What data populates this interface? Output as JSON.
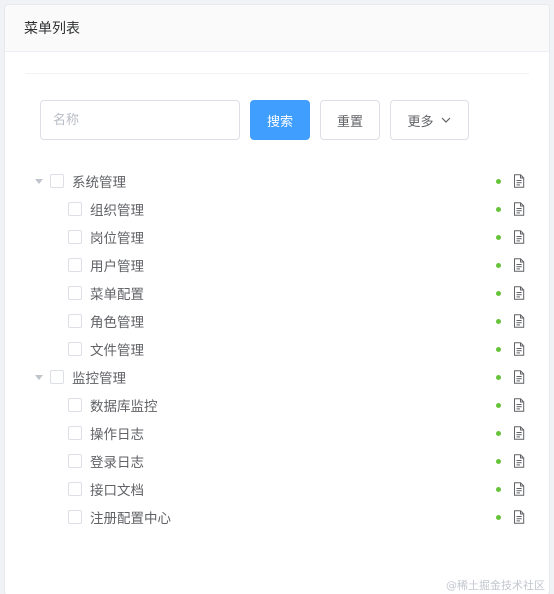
{
  "header": {
    "title": "菜单列表"
  },
  "toolbar": {
    "search_placeholder": "名称",
    "search_value": "",
    "search_label": "搜索",
    "reset_label": "重置",
    "more_label": "更多"
  },
  "tree": [
    {
      "label": "系统管理",
      "level": 0,
      "expanded": true,
      "status": "enabled"
    },
    {
      "label": "组织管理",
      "level": 1,
      "status": "enabled"
    },
    {
      "label": "岗位管理",
      "level": 1,
      "status": "enabled"
    },
    {
      "label": "用户管理",
      "level": 1,
      "status": "enabled"
    },
    {
      "label": "菜单配置",
      "level": 1,
      "status": "enabled"
    },
    {
      "label": "角色管理",
      "level": 1,
      "status": "enabled"
    },
    {
      "label": "文件管理",
      "level": 1,
      "status": "enabled"
    },
    {
      "label": "监控管理",
      "level": 0,
      "expanded": true,
      "status": "enabled"
    },
    {
      "label": "数据库监控",
      "level": 1,
      "status": "enabled"
    },
    {
      "label": "操作日志",
      "level": 1,
      "status": "enabled"
    },
    {
      "label": "登录日志",
      "level": 1,
      "status": "enabled"
    },
    {
      "label": "接口文档",
      "level": 1,
      "status": "enabled"
    },
    {
      "label": "注册配置中心",
      "level": 1,
      "status": "enabled"
    }
  ],
  "colors": {
    "primary": "#409eff",
    "status_enabled": "#67c23a"
  },
  "icons": {
    "expand": "caret-down-icon",
    "row_action": "document-icon",
    "more": "chevron-down-icon"
  },
  "watermark": "@稀土掘金技术社区"
}
